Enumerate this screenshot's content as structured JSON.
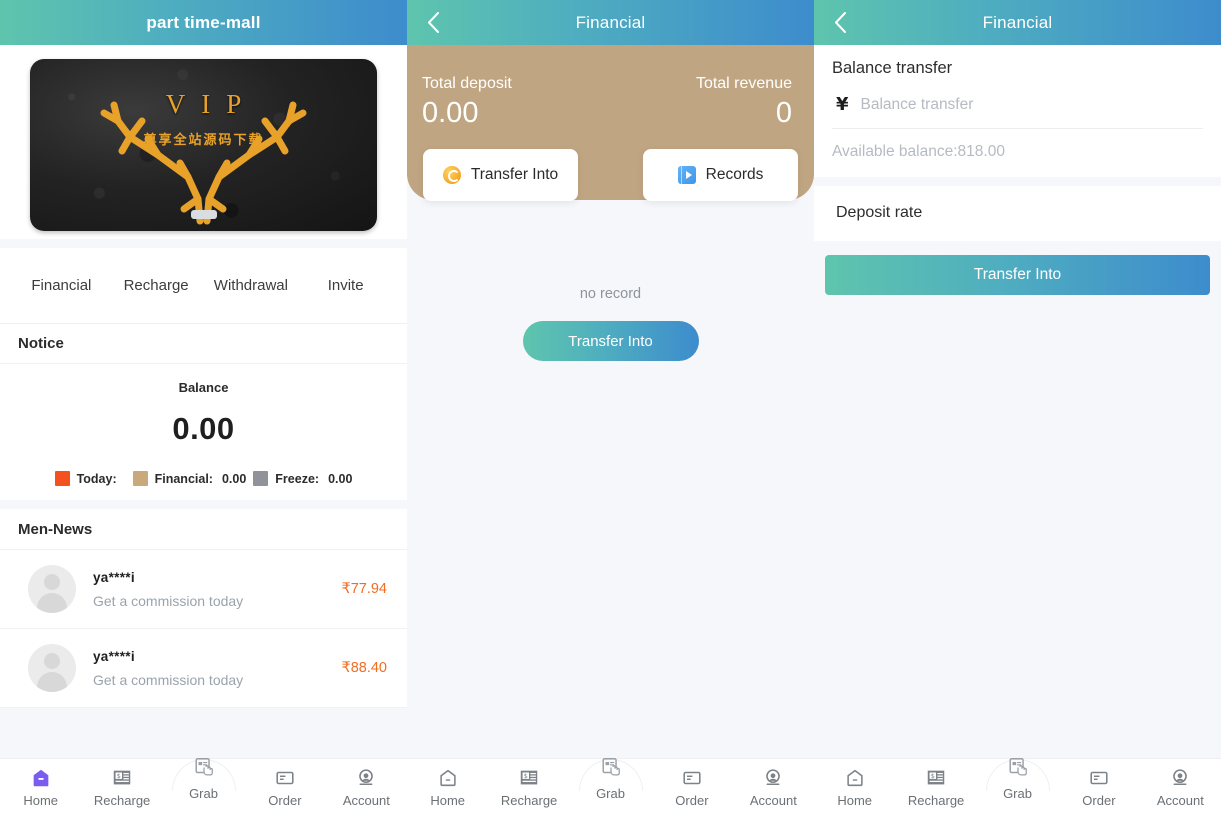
{
  "colors": {
    "header_start": "#5ec5ad",
    "header_end": "#3d8ccd",
    "banner_tan": "#c0a582",
    "accent_orange": "#f26d21",
    "legend_today": "#f4511e",
    "legend_financial": "#c9a87c",
    "legend_freeze": "#909399",
    "active_nav": "#7b5cf0"
  },
  "left_panel": {
    "header": {
      "title": "part time-mall"
    },
    "banner": {
      "vip_text": "VIP",
      "vip_subtext": "尊享全站源码下载"
    },
    "quicknav": [
      {
        "label": "Financial"
      },
      {
        "label": "Recharge"
      },
      {
        "label": "Withdrawal"
      },
      {
        "label": "Invite"
      }
    ],
    "notice": {
      "title": "Notice"
    },
    "balance": {
      "label": "Balance",
      "amount": "0.00",
      "legend": [
        {
          "name": "Today:",
          "value": "",
          "color": "#f4511e"
        },
        {
          "name": "Financial:",
          "value": "0.00",
          "color": "#c9a87c"
        },
        {
          "name": "Freeze:",
          "value": "0.00",
          "color": "#909399"
        }
      ]
    },
    "news": {
      "title": "Men-News",
      "rows": [
        {
          "user": "ya****i",
          "desc": "Get a commission today",
          "amount": "₹77.94"
        },
        {
          "user": "ya****i",
          "desc": "Get a commission today",
          "amount": "₹88.40"
        }
      ]
    },
    "tabbar": [
      {
        "label": "Home",
        "icon": "home-icon",
        "active": true
      },
      {
        "label": "Recharge",
        "icon": "receipt-icon",
        "active": false
      },
      {
        "label": "Grab",
        "icon": "grab-hand-icon",
        "active": false
      },
      {
        "label": "Order",
        "icon": "order-doc-icon",
        "active": false
      },
      {
        "label": "Account",
        "icon": "account-person-icon",
        "active": false
      }
    ]
  },
  "middle_panel": {
    "header": {
      "title": "Financial",
      "back": "back-chevron-icon"
    },
    "stats": {
      "deposit_label": "Total deposit",
      "deposit_value": "0.00",
      "revenue_label": "Total revenue",
      "revenue_value": "0"
    },
    "actions": [
      {
        "label": "Transfer Into",
        "icon": "coin-icon"
      },
      {
        "label": "Records",
        "icon": "records-book-icon"
      }
    ],
    "empty_text": "no record",
    "primary_button": "Transfer Into",
    "tabbar": [
      {
        "label": "Home",
        "icon": "home-icon",
        "active": false
      },
      {
        "label": "Recharge",
        "icon": "receipt-icon",
        "active": false
      },
      {
        "label": "Grab",
        "icon": "grab-hand-icon",
        "active": false
      },
      {
        "label": "Order",
        "icon": "order-doc-icon",
        "active": false
      },
      {
        "label": "Account",
        "icon": "account-person-icon",
        "active": false
      }
    ]
  },
  "right_panel": {
    "header": {
      "title": "Financial",
      "back": "back-chevron-icon"
    },
    "form": {
      "title": "Balance transfer",
      "currency_symbol": "¥",
      "input_value": "",
      "input_placeholder": "Balance transfer",
      "available": "Available balance:818.00"
    },
    "deposit_rate_label": "Deposit rate",
    "primary_button": "Transfer Into",
    "tabbar": [
      {
        "label": "Home",
        "icon": "home-icon",
        "active": false
      },
      {
        "label": "Recharge",
        "icon": "receipt-icon",
        "active": false
      },
      {
        "label": "Grab",
        "icon": "grab-hand-icon",
        "active": false
      },
      {
        "label": "Order",
        "icon": "order-doc-icon",
        "active": false
      },
      {
        "label": "Account",
        "icon": "account-person-icon",
        "active": false
      }
    ]
  }
}
